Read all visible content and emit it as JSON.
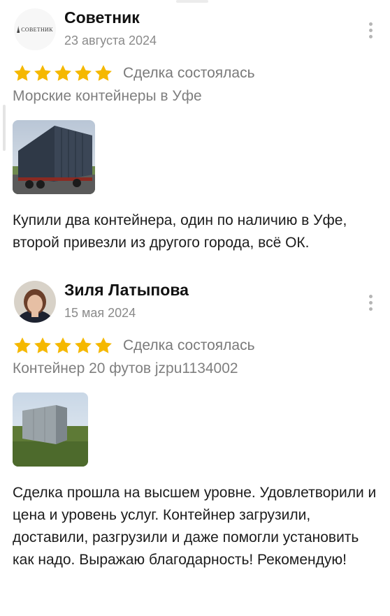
{
  "reviews": [
    {
      "author": "Советник",
      "logo_text": "СОВЕТНИК",
      "date": "23 августа 2024",
      "rating": 5,
      "deal_status": "Сделка состоялась",
      "product": "Морские контейнеры в Уфе",
      "text": "Купили два контейнера, один по наличию в Уфе, второй привезли из другого города, всё ОК."
    },
    {
      "author": "Зиля Латыпова",
      "date": "15 мая 2024",
      "rating": 5,
      "deal_status": "Сделка состоялась",
      "product": "Контейнер 20 футов jzpu1134002",
      "text": "Сделка прошла на высшем уровне. Удовлетворили и цена и уровень услуг. Контейнер загрузили, доставили, разгрузили и даже помогли установить как надо. Выражаю благодарность! Рекомендую!"
    }
  ],
  "colors": {
    "star": "#f5b800",
    "muted_text": "#8a8a8a"
  },
  "icons": [
    "star-icon",
    "more-vertical-icon"
  ]
}
